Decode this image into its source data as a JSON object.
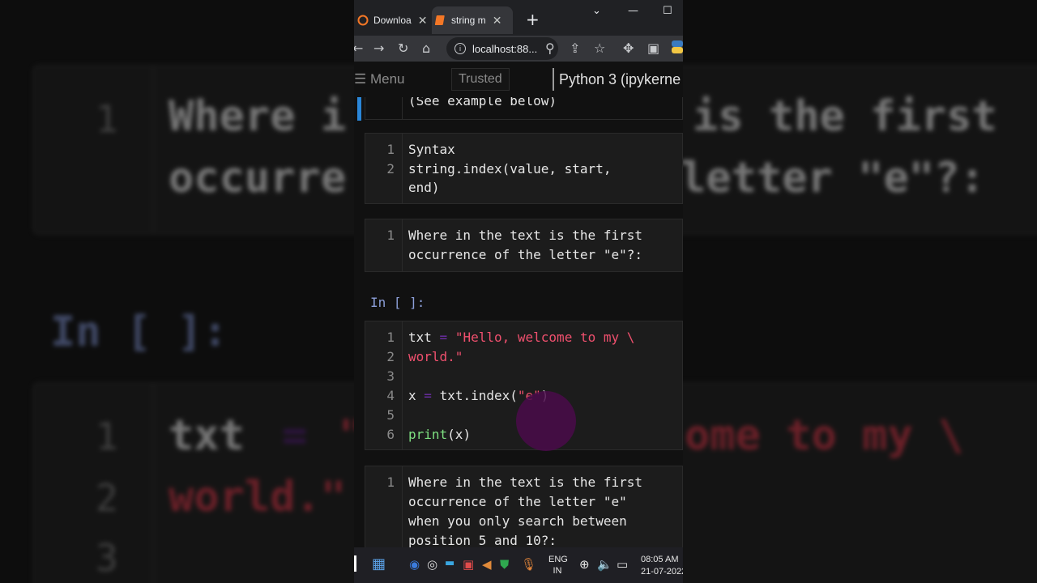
{
  "browser": {
    "tabs": [
      {
        "label": "Downloa",
        "icon": "jupyter-icon",
        "active": false
      },
      {
        "label": "string m",
        "icon": "notebook-icon",
        "active": true
      }
    ],
    "new_tab": "+",
    "url": "localhost:88..."
  },
  "jupyter": {
    "menu_label": "Menu",
    "trusted_label": "Trusted",
    "kernel_label": "Python 3 (ipykerne"
  },
  "cells": {
    "top_partial": "(See example below)",
    "syntax": {
      "nums": [
        "1",
        "2",
        ""
      ],
      "lines": [
        "Syntax",
        "string.index(value, start,",
        "end)"
      ]
    },
    "q1": {
      "nums": [
        "1",
        ""
      ],
      "lines": [
        "Where in the text is the first",
        "occurrence of the letter \"e\"?:"
      ]
    },
    "prompt": "In [ ]:",
    "code": {
      "nums": [
        "1",
        "2",
        "3",
        "4",
        "5",
        "6"
      ],
      "l1_var": "txt",
      "l1_eq": "=",
      "l1_str": "\"Hello, welcome to my \\",
      "l2_str": "world.\"",
      "l4_var": "x",
      "l4_eq": "=",
      "l4_call": "txt.index(",
      "l4_str": "\"e\"",
      "l4_close": ")",
      "l6_fn": "print",
      "l6_args": "(x)"
    },
    "q2": {
      "nums": [
        "1",
        "",
        "",
        ""
      ],
      "lines": [
        "Where in the text is the first",
        "occurrence of the letter \"e\"",
        "when you only search between",
        "position 5 and 10?:"
      ]
    }
  },
  "taskbar": {
    "lang_top": "ENG",
    "lang_bottom": "IN",
    "time": "08:05 AM",
    "date": "21-07-2022"
  },
  "background": {
    "line1": "Where i",
    "line1b": "is the first",
    "line2": "occurre",
    "line2b": "letter \"e\"?:",
    "prompt": "In [ ]:",
    "code1a": "txt",
    "code1b": "=",
    "code1c": "\"",
    "code1d": "ome to my \\",
    "code2": "world.\"",
    "nums": [
      "1",
      "1",
      "2",
      "3"
    ]
  }
}
